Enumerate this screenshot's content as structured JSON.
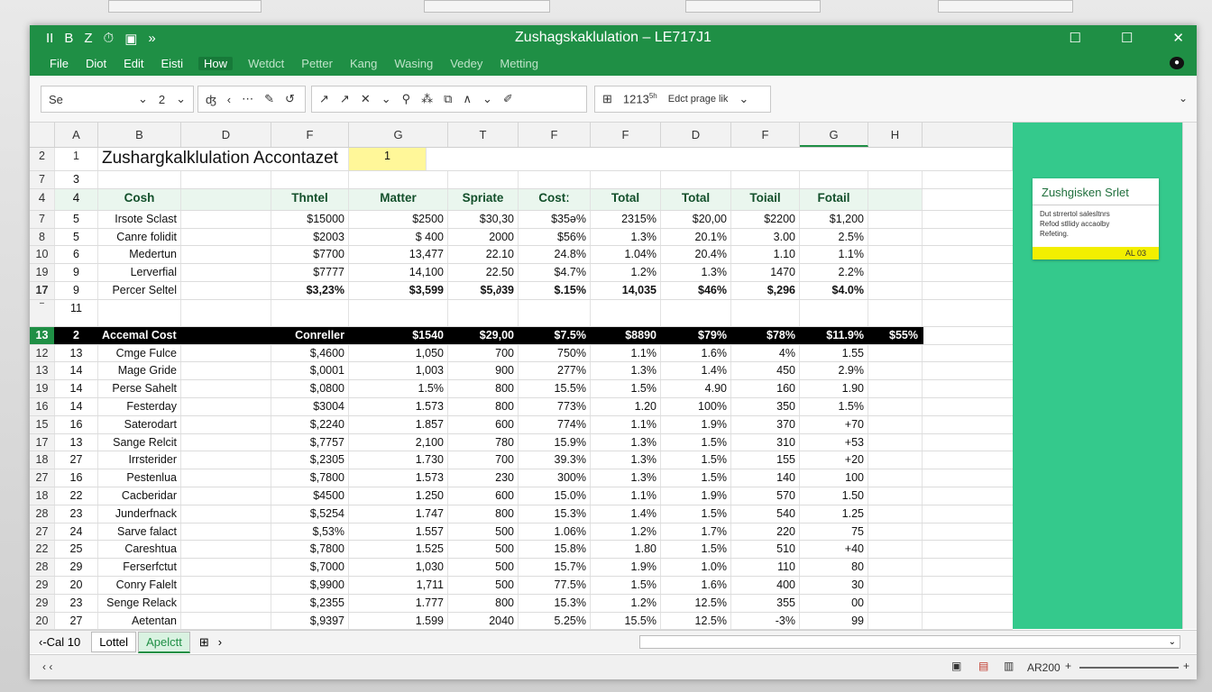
{
  "window": {
    "title": "Zushagskaklulation – LE717J1",
    "qat": [
      "II",
      "B",
      "Z",
      "⏱",
      "▣",
      "»"
    ],
    "controls": [
      "☐",
      "☐",
      "✕"
    ]
  },
  "menu": [
    "File",
    "Diot",
    "Edit",
    "Eisti",
    "How",
    "Wetdct",
    "Petter",
    "Kang",
    "Wasing",
    "Vedey",
    "Metting"
  ],
  "ribbon": {
    "font_name": "Se",
    "font_size": "2",
    "cell_ref": "1213",
    "cell_ref_sup": "5h",
    "edit_label": "Edct prage lik"
  },
  "columns": [
    "",
    "A",
    "B",
    "D",
    "F",
    "G",
    "T",
    "F",
    "F",
    "D",
    "F",
    "G",
    "H"
  ],
  "rows_top": [
    {
      "n": "2",
      "a": "1",
      "title": "Zushargkalklulation Accontazet",
      "e": "1"
    },
    {
      "n": "7",
      "a": "3"
    },
    {
      "n": "4",
      "a": "4",
      "header": [
        "Cosh",
        "",
        "Thntel",
        "Matter",
        "Spriate",
        "Costː",
        "Total",
        "Total",
        "Toiail",
        "Fotail"
      ]
    }
  ],
  "rows_a": [
    [
      "7",
      "5",
      "Irsote Sclast",
      "",
      "$15000",
      "$2500",
      "$30,30",
      "$35ǝ%",
      "2315%",
      "$20,00",
      "$2200",
      "$1,200"
    ],
    [
      "8",
      "5",
      "Canre folidit",
      "",
      "$2003",
      "$ 400",
      "2000",
      "$56%",
      "1.3%",
      "20.1%",
      "3.00",
      "2.5%"
    ],
    [
      "10",
      "6",
      "Medertun",
      "",
      "$7700",
      "13,477",
      "22.10",
      "24.8%",
      "1.04%",
      "20.4%",
      "1.10",
      "1.1%"
    ],
    [
      "19",
      "9",
      "Lerverfial",
      "",
      "$7777",
      "14,100",
      "22.50",
      "$4.7%",
      "1.2%",
      "1.3%",
      "1470",
      "2.2%"
    ]
  ],
  "row_total_a": [
    "17",
    "9",
    "Percer Seltel",
    "",
    "$3,23%",
    "$3,599",
    "$5,∂39",
    "$.15%",
    "14,035",
    "$46%",
    "$,296",
    "$4.0%"
  ],
  "row_blank": [
    "‾",
    "11"
  ],
  "row_section": [
    "13",
    "2",
    "Accemal Cost",
    "Conreller",
    "$1540",
    "$29,00",
    "$7.5%",
    "$8890",
    "$79%",
    "$78%",
    "$11.9%",
    "$55%"
  ],
  "rows_b": [
    [
      "12",
      "13",
      "Cmge Fulce",
      "",
      "$,4600",
      "1,050",
      "700",
      "750%",
      "1.1%",
      "1.6%",
      "4%",
      "1.55"
    ],
    [
      "13",
      "14",
      "Mage Gride",
      "",
      "$,0001",
      "1,003",
      "900",
      "277%",
      "1.3%",
      "1.4%",
      "450",
      "2.9%"
    ],
    [
      "19",
      "14",
      "Perse Sahelt",
      "",
      "$,0800",
      "1.5%",
      "800",
      "15.5%",
      "1.5%",
      "4.90",
      "160",
      "1.90"
    ],
    [
      "16",
      "14",
      "Festerday",
      "",
      "$3004",
      "1.573",
      "800",
      "773%",
      "1.20",
      "100%",
      "350",
      "1.5%"
    ],
    [
      "15",
      "16",
      "Saterodart",
      "",
      "$,2240",
      "1.857",
      "600",
      "774%",
      "1.1%",
      "1.9%",
      "370",
      "+70"
    ],
    [
      "17",
      "13",
      "Sange Relcit",
      "",
      "$,7757",
      "2,100",
      "780",
      "15.9%",
      "1.3%",
      "1.5%",
      "310",
      "+53"
    ],
    [
      "18",
      "27",
      "Irrsterider",
      "",
      "$,2305",
      "1.730",
      "700",
      "39.3%",
      "1.3%",
      "1.5%",
      "155",
      "+20"
    ],
    [
      "27",
      "16",
      "Pestenlua",
      "",
      "$,7800",
      "1.573",
      "230",
      "300%",
      "1.3%",
      "1.5%",
      "140",
      "100"
    ],
    [
      "18",
      "22",
      "Cacberidar",
      "",
      "$4500",
      "1.250",
      "600",
      "15.0%",
      "1.1%",
      "1.9%",
      "570",
      "1.50"
    ],
    [
      "28",
      "23",
      "Junderfnack",
      "",
      "$,5254",
      "1.747",
      "800",
      "15.3%",
      "1.4%",
      "1.5%",
      "540",
      "1.25"
    ],
    [
      "27",
      "24",
      "Sarve falact",
      "",
      "$,53%",
      "1.557",
      "500",
      "1.06%",
      "1.2%",
      "1.7%",
      "220",
      "75"
    ],
    [
      "22",
      "25",
      "Careshtua",
      "",
      "$,7800",
      "1.525",
      "500",
      "15.8%",
      "1.80",
      "1.5%",
      "510",
      "+40"
    ],
    [
      "28",
      "29",
      "Ferserfctut",
      "",
      "$,7000",
      "1,030",
      "500",
      "15.7%",
      "1.9%",
      "1.0%",
      "110",
      "80"
    ],
    [
      "29",
      "20",
      "Conry Falelt",
      "",
      "$,9900",
      "1,711",
      "500",
      "77.5%",
      "1.5%",
      "1.6%",
      "400",
      "30"
    ],
    [
      "29",
      "23",
      "Senge Relack",
      "",
      "$,2355",
      "1.777",
      "800",
      "15.3%",
      "1.2%",
      "12.5%",
      "355",
      "00"
    ],
    [
      "20",
      "27",
      "Aetentan",
      "",
      "$,9397",
      "1.599",
      "2040",
      "5.25%",
      "15.5%",
      "12.5%",
      "-3%",
      "99"
    ]
  ],
  "side_card": {
    "title": "Zushgisken Srlet",
    "lines": [
      "Dut strrertol salesltnrs",
      "Refod stllidy accaolby",
      "Refeting."
    ],
    "footer": "AL 03"
  },
  "sheet_tabs": {
    "nav": "‹-Cal 10",
    "tabs": [
      "Lottel",
      "Apelctt"
    ],
    "add": "⊞",
    "next": "›"
  },
  "status": {
    "left": "‹ ‹",
    "zoom": "AR200",
    "minus": "+",
    "plus": "+"
  }
}
